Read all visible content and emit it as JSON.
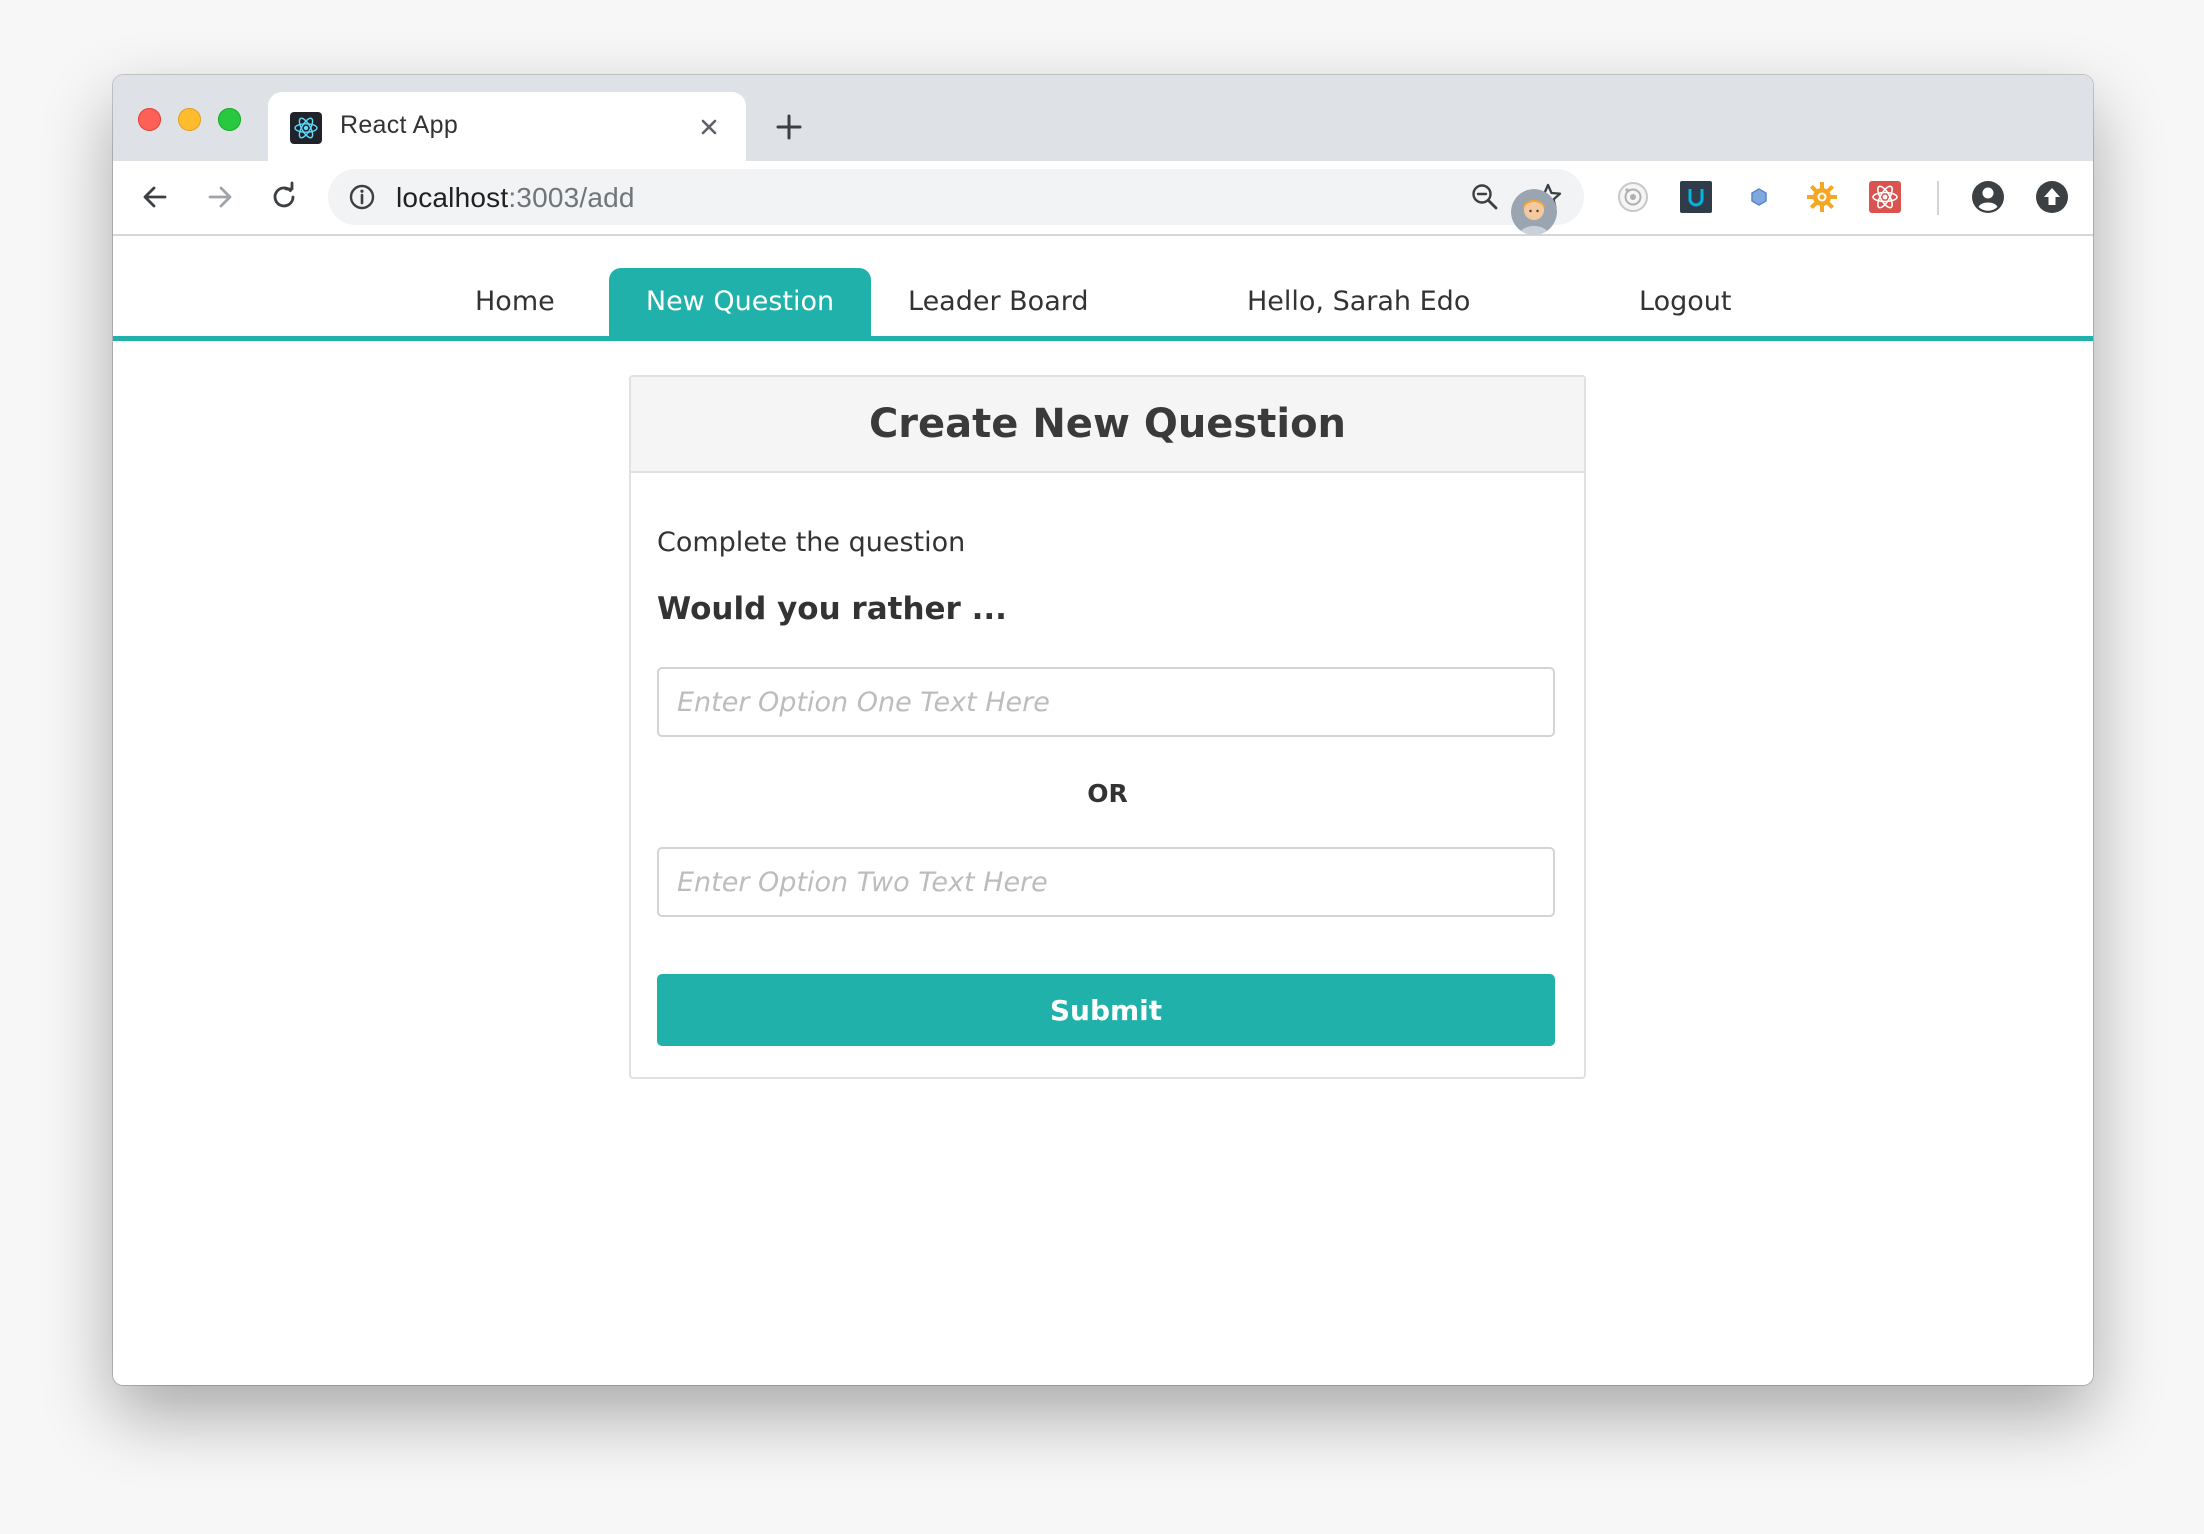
{
  "browser": {
    "tab_title": "React App",
    "url_host": "localhost",
    "url_path": ":3003/add"
  },
  "nav": {
    "home": "Home",
    "new_question": "New Question",
    "leader_board": "Leader Board",
    "greeting": "Hello, Sarah Edo",
    "logout": "Logout"
  },
  "form": {
    "title": "Create New Question",
    "instruction": "Complete the question",
    "prompt": "Would you rather ...",
    "option_one_placeholder": "Enter Option One Text Here",
    "option_two_placeholder": "Enter Option Two Text Here",
    "or_label": "OR",
    "submit_label": "Submit"
  },
  "colors": {
    "accent": "#20b2aa",
    "text": "#333333"
  },
  "icons": {
    "favicon": "react-icon",
    "extensions": [
      "camera-icon",
      "udacity-icon",
      "blue-hex-icon",
      "sun-gear-icon",
      "atom-red-icon",
      "account-icon",
      "upload-icon"
    ]
  }
}
